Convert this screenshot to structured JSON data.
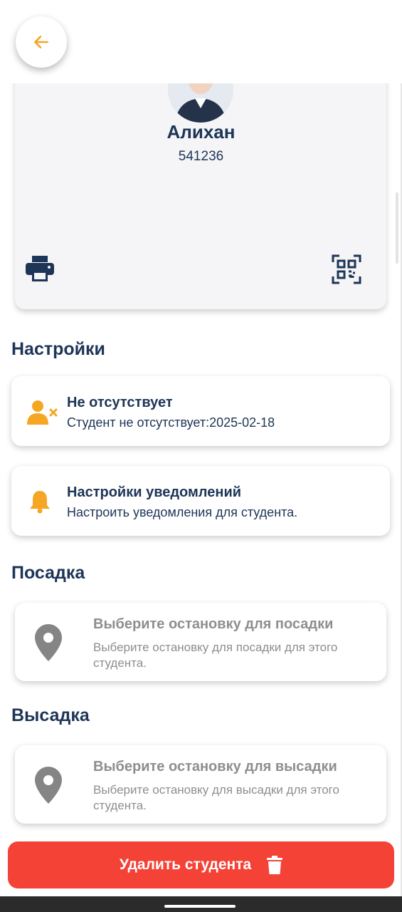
{
  "header": {
    "back_icon": "arrow-left-icon",
    "accent": "#f5a623"
  },
  "profile": {
    "name": "Алихан",
    "id": "541236",
    "print_icon": "printer-icon",
    "qr_icon": "qr-code-icon"
  },
  "settings": {
    "title": "Настройки",
    "absence": {
      "icon": "user-remove-icon",
      "title": "Не отсутствует",
      "subtitle": "Студент не отсутствует:2025-02-18"
    },
    "notifications": {
      "icon": "bell-icon",
      "title": "Настройки уведомлений",
      "subtitle": "Настроить уведомления для студента."
    }
  },
  "pickup": {
    "title": "Посадка",
    "card_title": "Выберите остановку для посадки",
    "card_subtitle": "Выберите остановку для посадки для этого студента.",
    "icon": "location-pin-icon"
  },
  "dropoff": {
    "title": "Высадка",
    "card_title": "Выберите остановку для высадки",
    "card_subtitle": "Выберите остановку для высадки для этого студента.",
    "icon": "location-pin-icon"
  },
  "actions": {
    "delete_label": "Удалить студента",
    "delete_icon": "trash-icon",
    "delete_color": "#f44336"
  },
  "colors": {
    "primary": "#1d3557",
    "accent": "#f5a623",
    "muted": "#8e8e8e"
  }
}
